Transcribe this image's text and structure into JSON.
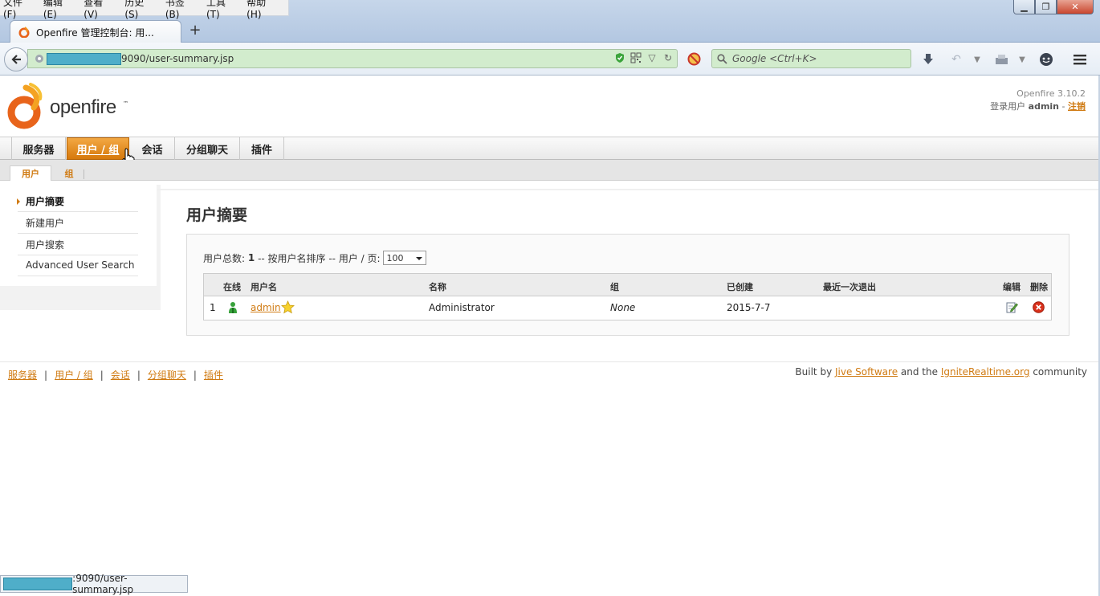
{
  "browser": {
    "menu": [
      "文件(F)",
      "编辑(E)",
      "查看(V)",
      "历史(S)",
      "书签(B)",
      "工具(T)",
      "帮助(H)"
    ],
    "tab_title": "Openfire 管理控制台: 用...",
    "url_suffix": "9090/user-summary.jsp",
    "search_placeholder": "Google <Ctrl+K>",
    "status_url": ":9090/user-summary.jsp"
  },
  "header": {
    "logo_text": "openfire",
    "logo_tm": "™",
    "version": "Openfire 3.10.2",
    "login_label": "登录用户",
    "login_user": "admin",
    "login_sep": "-",
    "logout_label": "注销"
  },
  "main_tabs": [
    {
      "label": "服务器",
      "active": false
    },
    {
      "label": "用户 / 组",
      "active": true
    },
    {
      "label": "会话",
      "active": false
    },
    {
      "label": "分组聊天",
      "active": false
    },
    {
      "label": "插件",
      "active": false
    }
  ],
  "sub_tabs": [
    {
      "label": "用户",
      "active": true
    },
    {
      "label": "组",
      "active": false
    }
  ],
  "sidebar": {
    "items": [
      {
        "label": "用户摘要",
        "active": true
      },
      {
        "label": "新建用户",
        "active": false
      },
      {
        "label": "用户搜索",
        "active": false
      },
      {
        "label": "Advanced User Search",
        "active": false
      }
    ]
  },
  "main": {
    "title": "用户摘要",
    "summary": {
      "total_label": "用户总数:",
      "total_value": "1",
      "sort_text": "-- 按用户名排序 -- 用户 / 页:",
      "per_page": "100"
    },
    "table": {
      "headers": [
        "在线",
        "用户名",
        "名称",
        "组",
        "已创建",
        "最近一次退出",
        "编辑",
        "删除"
      ],
      "rows": [
        {
          "index": "1",
          "username": "admin",
          "name": "Administrator",
          "groups": "None",
          "created": "2015-7-7",
          "last_logout": ""
        }
      ]
    }
  },
  "footer": {
    "links": [
      "服务器",
      "用户 / 组",
      "会话",
      "分组聊天",
      "插件"
    ],
    "credit_prefix": "Built by",
    "credit_jive": "Jive Software",
    "credit_mid": "and the",
    "credit_ignite": "IgniteRealtime.org",
    "credit_suffix": "community"
  },
  "colors": {
    "accent": "#d07b13",
    "active_tab": "#e8921f",
    "url_bar": "#d2eccd"
  }
}
